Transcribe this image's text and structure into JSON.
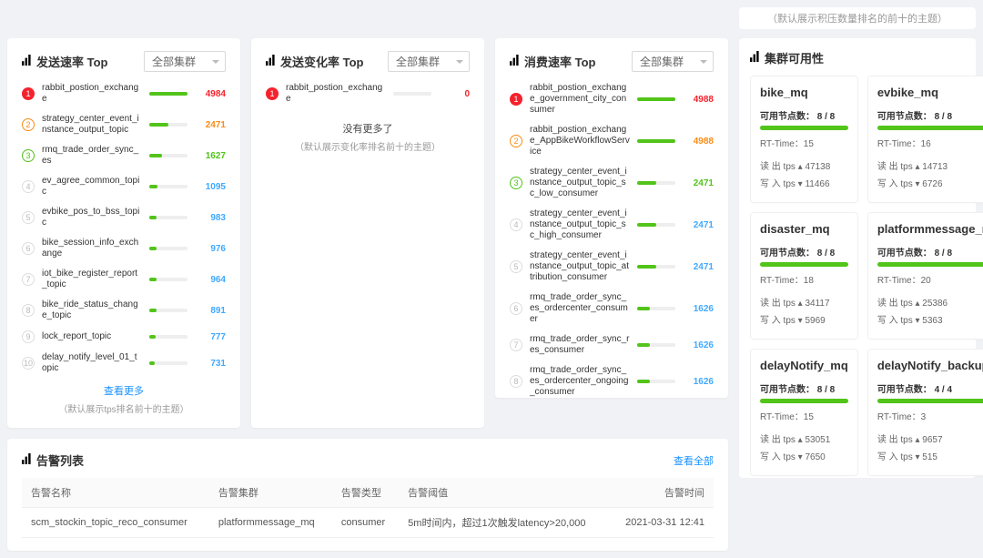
{
  "top_hint": "（默认展示积压数量排名的前十的主题）",
  "dropdown_all": "全部集群",
  "panels": {
    "send_rate": {
      "title": "发送速率 Top",
      "items": [
        {
          "rank": 1,
          "badge": "rank-1",
          "name": "rabbit_postion_exchange",
          "value": "4984",
          "color": "vr",
          "pct": 100
        },
        {
          "rank": 2,
          "badge": "rank-2",
          "name": "strategy_center_event_instance_output_topic",
          "value": "2471",
          "color": "vo",
          "pct": 50
        },
        {
          "rank": 3,
          "badge": "rank-3",
          "name": "rmq_trade_order_sync_es",
          "value": "1627",
          "color": "vg",
          "pct": 33
        },
        {
          "rank": 4,
          "badge": "rank-g",
          "name": "ev_agree_common_topic",
          "value": "1095",
          "color": "vb",
          "pct": 22
        },
        {
          "rank": 5,
          "badge": "rank-g",
          "name": "evbike_pos_to_bss_topic",
          "value": "983",
          "color": "vb",
          "pct": 20
        },
        {
          "rank": 6,
          "badge": "rank-g",
          "name": "bike_session_info_exchange",
          "value": "976",
          "color": "vb",
          "pct": 20
        },
        {
          "rank": 7,
          "badge": "rank-g",
          "name": "iot_bike_register_report_topic",
          "value": "964",
          "color": "vb",
          "pct": 19
        },
        {
          "rank": 8,
          "badge": "rank-g",
          "name": "bike_ride_status_change_topic",
          "value": "891",
          "color": "vb",
          "pct": 18
        },
        {
          "rank": 9,
          "badge": "rank-g",
          "name": "lock_report_topic",
          "value": "777",
          "color": "vb",
          "pct": 16
        },
        {
          "rank": 10,
          "badge": "rank-g",
          "name": "delay_notify_level_01_topic",
          "value": "731",
          "color": "vb",
          "pct": 15
        }
      ],
      "more": "查看更多",
      "hint": "（默认展示tps排名前十的主题）"
    },
    "change_rate": {
      "title": "发送变化率 Top",
      "items": [
        {
          "rank": 1,
          "badge": "rank-1",
          "name": "rabbit_postion_exchange",
          "value": "0",
          "color": "vr",
          "pct": 0
        }
      ],
      "empty": "没有更多了",
      "hint": "（默认展示变化率排名前十的主题）"
    },
    "consume_rate": {
      "title": "消费速率 Top",
      "items": [
        {
          "rank": 1,
          "badge": "rank-1",
          "name": "rabbit_postion_exchange_government_city_consumer",
          "value": "4988",
          "color": "vr",
          "pct": 100
        },
        {
          "rank": 2,
          "badge": "rank-2",
          "name": "rabbit_postion_exchange_AppBikeWorkflowService",
          "value": "4988",
          "color": "vo",
          "pct": 100
        },
        {
          "rank": 3,
          "badge": "rank-3",
          "name": "strategy_center_event_instance_output_topic_sc_low_consumer",
          "value": "2471",
          "color": "vg",
          "pct": 50
        },
        {
          "rank": 4,
          "badge": "rank-g",
          "name": "strategy_center_event_instance_output_topic_sc_high_consumer",
          "value": "2471",
          "color": "vb",
          "pct": 50
        },
        {
          "rank": 5,
          "badge": "rank-g",
          "name": "strategy_center_event_instance_output_topic_attribution_consumer",
          "value": "2471",
          "color": "vb",
          "pct": 50
        },
        {
          "rank": 6,
          "badge": "rank-g",
          "name": "rmq_trade_order_sync_es_ordercenter_consumer",
          "value": "1626",
          "color": "vb",
          "pct": 33
        },
        {
          "rank": 7,
          "badge": "rank-g",
          "name": "rmq_trade_order_sync_res_consumer",
          "value": "1626",
          "color": "vb",
          "pct": 33
        },
        {
          "rank": 8,
          "badge": "rank-g",
          "name": "rmq_trade_order_sync_es_ordercenter_ongoing_consumer",
          "value": "1626",
          "color": "vb",
          "pct": 33
        }
      ]
    }
  },
  "alarm": {
    "title": "告警列表",
    "view_all": "查看全部",
    "headers": {
      "name": "告警名称",
      "cluster": "告警集群",
      "type": "告警类型",
      "threshold": "告警阈值",
      "time": "告警时间"
    },
    "rows": [
      {
        "name": "scm_stockin_topic_reco_consumer",
        "cluster": "platformmessage_mq",
        "type": "consumer",
        "threshold": "5m时间内，超过1次触发latency>20,000",
        "time": "2021-03-31 12:41"
      }
    ]
  },
  "cluster": {
    "title": "集群可用性",
    "cards": [
      {
        "name": "bike_mq",
        "nodes": "可用节点数： 8 / 8",
        "rt": "RT-Time：15",
        "out": "读 出 tps ▴ 47138",
        "in": "写 入 tps ▾ 11466"
      },
      {
        "name": "evbike_mq",
        "nodes": "可用节点数： 8 / 8",
        "rt": "RT-Time：16",
        "out": "读 出 tps ▴ 14713",
        "in": "写 入 tps ▾ 6726"
      },
      {
        "name": "disaster_mq",
        "nodes": "可用节点数： 8 / 8",
        "rt": "RT-Time：18",
        "out": "读 出 tps ▴ 34117",
        "in": "写 入 tps ▾ 5969"
      },
      {
        "name": "platformmessage_mq",
        "nodes": "可用节点数： 8 / 8",
        "rt": "RT-Time：20",
        "out": "读 出 tps ▴ 25386",
        "in": "写 入 tps ▾ 5363"
      },
      {
        "name": "delayNotify_mq",
        "nodes": "可用节点数： 8 / 8",
        "rt": "RT-Time：15",
        "out": "读 出 tps ▴ 53051",
        "in": "写 入 tps ▾ 7650"
      },
      {
        "name": "delayNotify_backup_mq",
        "nodes": "可用节点数： 4 / 4",
        "rt": "RT-Time：3",
        "out": "读 出 tps ▴ 9657",
        "in": "写 入 tps ▾ 515"
      }
    ]
  }
}
